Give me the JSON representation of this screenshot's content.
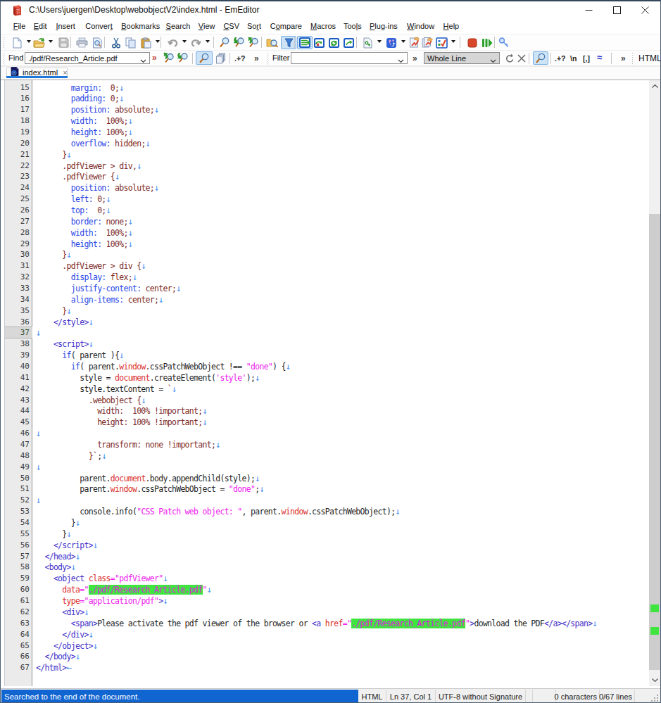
{
  "window": {
    "title": "C:\\Users\\juergen\\Desktop\\webobjectV2\\index.html - EmEditor",
    "app_icon": "emeditor-icon",
    "controls": [
      {
        "name": "minimize-button",
        "icon": "minimize-icon"
      },
      {
        "name": "maximize-button",
        "icon": "maximize-icon"
      },
      {
        "name": "close-button",
        "icon": "close-icon"
      }
    ]
  },
  "menu": {
    "items": [
      {
        "label": "File",
        "u": 0
      },
      {
        "label": "Edit",
        "u": 0
      },
      {
        "label": "Insert",
        "u": 0
      },
      {
        "label": "Convert",
        "u": 6
      },
      {
        "label": "Bookmarks",
        "u": 0
      },
      {
        "label": "Search",
        "u": 0
      },
      {
        "label": "View",
        "u": 0
      },
      {
        "label": "CSV",
        "u": 0
      },
      {
        "label": "Sort",
        "u": 2
      },
      {
        "label": "Compare",
        "u": 1
      },
      {
        "label": "Macros",
        "u": 0
      },
      {
        "label": "Tools",
        "u": 3
      },
      {
        "label": "Plug-ins",
        "u": 0
      },
      {
        "label": "Window",
        "u": 0
      },
      {
        "label": "Help",
        "u": 0
      }
    ]
  },
  "toolbar_main": {
    "items": [
      {
        "icon": "new-document-icon",
        "caret": true
      },
      {
        "icon": "open-folder-icon",
        "caret": true
      },
      {
        "icon": "save-icon",
        "disabled": true
      },
      {
        "sep": true
      },
      {
        "icon": "print-icon",
        "disabled": true
      },
      {
        "icon": "print-preview-icon"
      },
      {
        "sep": true
      },
      {
        "icon": "cut-icon"
      },
      {
        "icon": "copy-icon"
      },
      {
        "icon": "paste-icon",
        "caret": true
      },
      {
        "sep": true
      },
      {
        "icon": "undo-icon",
        "disabled": true,
        "caret": true
      },
      {
        "icon": "redo-icon",
        "disabled": true,
        "caret": true
      },
      {
        "sep": true
      },
      {
        "icon": "find-icon"
      },
      {
        "icon": "find-next-icon"
      },
      {
        "icon": "find-previous-icon"
      },
      {
        "sep": true
      },
      {
        "icon": "find-in-files-icon"
      },
      {
        "icon": "filter-icon",
        "active": true
      },
      {
        "sep": true
      },
      {
        "icon": "csv-normal-mode-icon",
        "boxed": true
      },
      {
        "icon": "csv-convert-icon"
      },
      {
        "icon": "csv-reload-icon"
      },
      {
        "icon": "csv-export-icon"
      },
      {
        "sep": true
      },
      {
        "icon": "macro-page-icon",
        "caret": true
      },
      {
        "icon": "external-tools-icon",
        "caret": true
      },
      {
        "icon": "macro-record-icon"
      },
      {
        "icon": "macro-run-icon"
      },
      {
        "icon": "macro-options-icon",
        "caret": true
      },
      {
        "sep": true
      },
      {
        "icon": "stop-icon"
      },
      {
        "icon": "run-all-icon"
      },
      {
        "sep": true
      },
      {
        "icon": "password-key-icon"
      }
    ]
  },
  "findbar": {
    "find_label": "Find",
    "find_value": "./pdf/Research_Article.pdf",
    "overflow_chevron": "»",
    "icons_left": [
      "find-previous-green-icon",
      "find-next-green-icon",
      "incremental-search-icon",
      "pages-icon"
    ],
    "regex_option": ".+?",
    "chevron2": "»",
    "filter_label": "Filter",
    "filter_value": "",
    "scope_value": "Whole Line",
    "scope_icons": [
      "refresh-icon",
      "clear-icon",
      "magnifier-icon"
    ],
    "options": [
      ".+?",
      "\\n",
      "[,]",
      "≈"
    ],
    "chevron3": "»",
    "right_label": "HTML"
  },
  "tabbar": {
    "tabs": [
      {
        "label": "index.html",
        "icon": "html-file-icon",
        "close": "×",
        "active": true
      }
    ]
  },
  "editor": {
    "first_line": 15,
    "current_line": 37,
    "lines": [
      {
        "n": 15,
        "seg": [
          [
            "c0",
            "        "
          ],
          [
            "cb",
            "margin:"
          ],
          [
            "cm",
            "  0;"
          ]
        ],
        "eol": "d"
      },
      {
        "n": 16,
        "seg": [
          [
            "c0",
            "        "
          ],
          [
            "cb",
            "padding:"
          ],
          [
            "cm",
            " 0;"
          ]
        ],
        "eol": "d"
      },
      {
        "n": 17,
        "seg": [
          [
            "c0",
            "        "
          ],
          [
            "cb",
            "position:"
          ],
          [
            "cm",
            " absolute;"
          ]
        ],
        "eol": "d"
      },
      {
        "n": 18,
        "seg": [
          [
            "c0",
            "        "
          ],
          [
            "cb",
            "width:"
          ],
          [
            "cm",
            "  100%;"
          ]
        ],
        "eol": "d"
      },
      {
        "n": 19,
        "seg": [
          [
            "c0",
            "        "
          ],
          [
            "cb",
            "height:"
          ],
          [
            "cm",
            " 100%;"
          ]
        ],
        "eol": "d"
      },
      {
        "n": 20,
        "seg": [
          [
            "c0",
            "        "
          ],
          [
            "cb",
            "overflow:"
          ],
          [
            "cm",
            " hidden;"
          ]
        ],
        "eol": "d"
      },
      {
        "n": 21,
        "seg": [
          [
            "cm",
            "      }"
          ]
        ],
        "eol": "d"
      },
      {
        "n": 22,
        "seg": [
          [
            "cm",
            "      .pdfViewer > div,"
          ]
        ],
        "eol": "d"
      },
      {
        "n": 23,
        "seg": [
          [
            "cm",
            "      .pdfViewer {"
          ]
        ],
        "eol": "d"
      },
      {
        "n": 24,
        "seg": [
          [
            "c0",
            "        "
          ],
          [
            "cb",
            "position:"
          ],
          [
            "cm",
            " absolute;"
          ]
        ],
        "eol": "d"
      },
      {
        "n": 25,
        "seg": [
          [
            "c0",
            "        "
          ],
          [
            "cb",
            "left:"
          ],
          [
            "cm",
            " 0;"
          ]
        ],
        "eol": "d"
      },
      {
        "n": 26,
        "seg": [
          [
            "c0",
            "        "
          ],
          [
            "cb",
            "top:"
          ],
          [
            "cm",
            "  0;"
          ]
        ],
        "eol": "d"
      },
      {
        "n": 27,
        "seg": [
          [
            "c0",
            "        "
          ],
          [
            "cb",
            "border:"
          ],
          [
            "cm",
            " none;"
          ]
        ],
        "eol": "d"
      },
      {
        "n": 28,
        "seg": [
          [
            "c0",
            "        "
          ],
          [
            "cb",
            "width:"
          ],
          [
            "cm",
            "  100%;"
          ]
        ],
        "eol": "d"
      },
      {
        "n": 29,
        "seg": [
          [
            "c0",
            "        "
          ],
          [
            "cb",
            "height:"
          ],
          [
            "cm",
            " 100%;"
          ]
        ],
        "eol": "d"
      },
      {
        "n": 30,
        "seg": [
          [
            "cm",
            "      }"
          ]
        ],
        "eol": "d"
      },
      {
        "n": 31,
        "seg": [
          [
            "cm",
            "      .pdfViewer > div {"
          ]
        ],
        "eol": "d"
      },
      {
        "n": 32,
        "seg": [
          [
            "c0",
            "        "
          ],
          [
            "cb",
            "display:"
          ],
          [
            "cm",
            " flex;"
          ]
        ],
        "eol": "d"
      },
      {
        "n": 33,
        "seg": [
          [
            "c0",
            "        "
          ],
          [
            "cb",
            "justify-content:"
          ],
          [
            "cm",
            " center;"
          ]
        ],
        "eol": "d"
      },
      {
        "n": 34,
        "seg": [
          [
            "c0",
            "        "
          ],
          [
            "cb",
            "align-items:"
          ],
          [
            "cm",
            " center;"
          ]
        ],
        "eol": "d"
      },
      {
        "n": 35,
        "seg": [
          [
            "cm",
            "      }"
          ]
        ],
        "eol": "d"
      },
      {
        "n": 36,
        "seg": [
          [
            "ct",
            "    </style>"
          ]
        ],
        "eol": "d"
      },
      {
        "n": 37,
        "seg": [],
        "eol": "d"
      },
      {
        "n": 38,
        "seg": [
          [
            "ct",
            "    <script>"
          ]
        ],
        "eol": "d"
      },
      {
        "n": 39,
        "seg": [
          [
            "c0",
            "      "
          ],
          [
            "cb",
            "if"
          ],
          [
            "c0",
            "( parent ){"
          ]
        ],
        "eol": "d"
      },
      {
        "n": 40,
        "seg": [
          [
            "c0",
            "        "
          ],
          [
            "cb",
            "if"
          ],
          [
            "c0",
            "( parent."
          ],
          [
            "cr",
            "window"
          ],
          [
            "c0",
            ".cssPatchWebObject !== "
          ],
          [
            "cs",
            "\"done\""
          ],
          [
            "c0",
            ") {"
          ]
        ],
        "eol": "d"
      },
      {
        "n": 41,
        "seg": [
          [
            "c0",
            "          style = "
          ],
          [
            "cr",
            "document"
          ],
          [
            "c0",
            ".createElement("
          ],
          [
            "cs",
            "'style'"
          ],
          [
            "c0",
            ");"
          ]
        ],
        "eol": "d"
      },
      {
        "n": 42,
        "seg": [
          [
            "c0",
            "          style.textContent = "
          ],
          [
            "cm",
            "`"
          ]
        ],
        "eol": "d"
      },
      {
        "n": 43,
        "seg": [
          [
            "cm",
            "            .webobject {"
          ]
        ],
        "eol": "d"
      },
      {
        "n": 44,
        "seg": [
          [
            "cm",
            "              width:  100% !important;"
          ]
        ],
        "eol": "d"
      },
      {
        "n": 45,
        "seg": [
          [
            "cm",
            "              height: 100% !important;"
          ]
        ],
        "eol": "d"
      },
      {
        "n": 46,
        "seg": [],
        "eol": "d"
      },
      {
        "n": 47,
        "seg": [
          [
            "cm",
            "              transform: none !important;"
          ]
        ],
        "eol": "d"
      },
      {
        "n": 48,
        "seg": [
          [
            "cm",
            "            }`"
          ],
          [
            "c0",
            ";"
          ]
        ],
        "eol": "d"
      },
      {
        "n": 49,
        "seg": [],
        "eol": "d"
      },
      {
        "n": 50,
        "seg": [
          [
            "c0",
            "          parent."
          ],
          [
            "cr",
            "document"
          ],
          [
            "c0",
            ".body.appendChild(style);"
          ]
        ],
        "eol": "d"
      },
      {
        "n": 51,
        "seg": [
          [
            "c0",
            "          parent."
          ],
          [
            "cr",
            "window"
          ],
          [
            "c0",
            ".cssPatchWebObject = "
          ],
          [
            "cs",
            "\"done\""
          ],
          [
            "c0",
            ";"
          ]
        ],
        "eol": "d"
      },
      {
        "n": 52,
        "seg": [],
        "eol": "d"
      },
      {
        "n": 53,
        "seg": [
          [
            "c0",
            "          console.info("
          ],
          [
            "cs",
            "\"CSS Patch web object: \""
          ],
          [
            "c0",
            ", parent."
          ],
          [
            "cr",
            "window"
          ],
          [
            "c0",
            ".cssPatchWebObject);"
          ]
        ],
        "eol": "d"
      },
      {
        "n": 54,
        "seg": [
          [
            "c0",
            "        }"
          ]
        ],
        "eol": "d"
      },
      {
        "n": 55,
        "seg": [
          [
            "c0",
            "      }"
          ]
        ],
        "eol": "d"
      },
      {
        "n": 56,
        "seg": [
          [
            "ct",
            "    </script>"
          ]
        ],
        "eol": "d"
      },
      {
        "n": 57,
        "seg": [
          [
            "ct",
            "  </head>"
          ]
        ],
        "eol": "d"
      },
      {
        "n": 58,
        "seg": [
          [
            "ct",
            "  <body>"
          ]
        ],
        "eol": "d"
      },
      {
        "n": 59,
        "seg": [
          [
            "ct",
            "    <object"
          ],
          [
            "c0",
            " "
          ],
          [
            "cr",
            "class"
          ],
          [
            "cs",
            "=\"pdfViewer\""
          ]
        ],
        "eol": "d"
      },
      {
        "n": 60,
        "seg": [
          [
            "c0",
            "      "
          ],
          [
            "cr",
            "data"
          ],
          [
            "cs",
            "=\""
          ],
          [
            "cg",
            "./pdf/Research_Article.pdf"
          ],
          [
            "cs",
            "\""
          ]
        ],
        "eol": "d"
      },
      {
        "n": 61,
        "seg": [
          [
            "c0",
            "      "
          ],
          [
            "cr",
            "type"
          ],
          [
            "cs",
            "=\"application/pdf\""
          ],
          [
            "ct",
            ">"
          ]
        ],
        "eol": "d"
      },
      {
        "n": 62,
        "seg": [
          [
            "ct",
            "      <div>"
          ]
        ],
        "eol": "d"
      },
      {
        "n": 63,
        "seg": [
          [
            "ct",
            "        <span>"
          ],
          [
            "c0",
            "Please activate the pdf viewer of the browser or "
          ],
          [
            "ct",
            "<a"
          ],
          [
            "c0",
            " "
          ],
          [
            "cr",
            "href"
          ],
          [
            "cs",
            "=\""
          ],
          [
            "cg",
            "./pdf/Research_Article.pdf"
          ],
          [
            "cs",
            "\""
          ],
          [
            "ct",
            ">"
          ],
          [
            "c0",
            "download the PDF"
          ],
          [
            "ct",
            "</a></span>"
          ]
        ],
        "eol": "d"
      },
      {
        "n": 64,
        "seg": [
          [
            "ct",
            "      </div>"
          ]
        ],
        "eol": "d"
      },
      {
        "n": 65,
        "seg": [
          [
            "ct",
            "    </object>"
          ]
        ],
        "eol": "d"
      },
      {
        "n": 66,
        "seg": [
          [
            "ct",
            "  </body>"
          ]
        ],
        "eol": "d"
      },
      {
        "n": 67,
        "seg": [
          [
            "ct",
            "</html>"
          ]
        ],
        "eol": "l"
      }
    ],
    "match_highlight_color": "#3fe43f",
    "scrollbar_marker_color": "#3fe43f"
  },
  "statusbar": {
    "message": "Searched to the end of the document.",
    "segments": [
      "HTML",
      "Ln 37, Col 1",
      "UTF-8 without Signature",
      "",
      "",
      "0 characters",
      "0/67 lines",
      ""
    ]
  }
}
